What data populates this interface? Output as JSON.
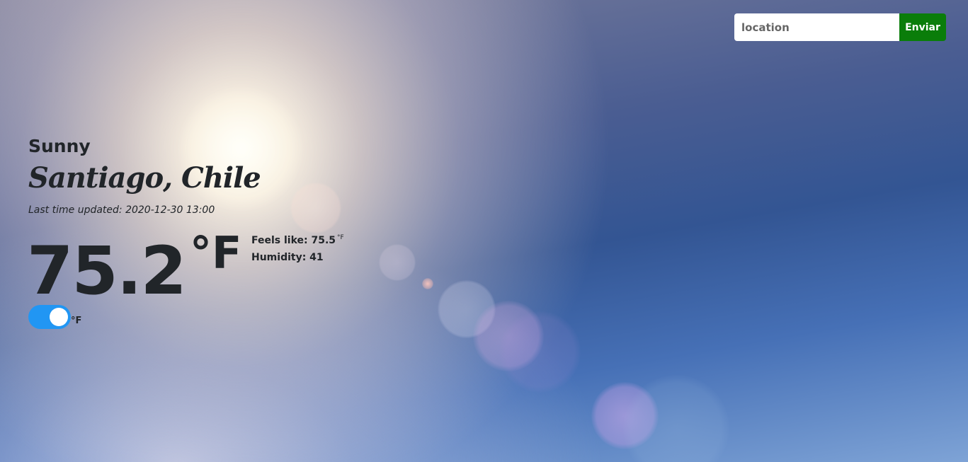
{
  "search": {
    "placeholder": "location",
    "button_label": "Enviar"
  },
  "weather": {
    "condition": "Sunny",
    "location": "Santiago, Chile",
    "last_updated": "Last time updated: 2020-12-30 13:00",
    "temperature": "75.2",
    "unit": "°F",
    "feels_like_label": "Feels like: 75.5",
    "feels_like_unit": "°F",
    "humidity_label": "Humidity: 41"
  },
  "unit_toggle": {
    "label": "°F",
    "checked": true,
    "active_color": "#2196f3"
  },
  "colors": {
    "button": "#0a7d0a",
    "text": "#212529"
  }
}
